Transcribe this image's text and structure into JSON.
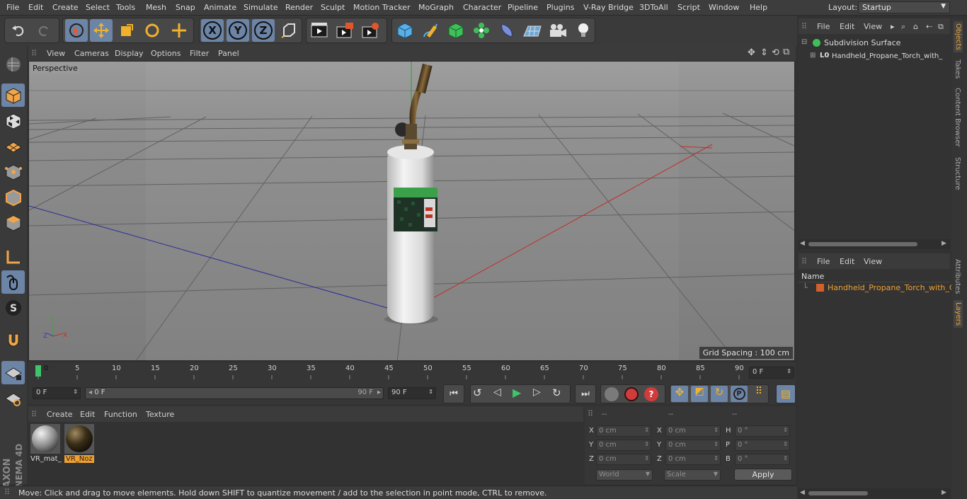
{
  "menu": [
    "File",
    "Edit",
    "Create",
    "Select",
    "Tools",
    "Mesh",
    "Snap",
    "Animate",
    "Simulate",
    "Render",
    "Sculpt",
    "Motion Tracker",
    "MoGraph",
    "Character",
    "Pipeline",
    "Plugins",
    "V-Ray Bridge",
    "3DToAll",
    "Script",
    "Window",
    "Help"
  ],
  "layout": {
    "label": "Layout:",
    "value": "Startup"
  },
  "toolbar": {
    "undo": "undo-icon",
    "redo": "redo-icon",
    "axis_x": "X",
    "axis_y": "Y",
    "axis_z": "Z"
  },
  "viewport": {
    "menu": [
      "View",
      "Cameras",
      "Display",
      "Options",
      "Filter",
      "Panel"
    ],
    "label": "Perspective",
    "grid_spacing": "Grid Spacing : 100 cm",
    "axis_y": "Y",
    "axis_x": "X",
    "axis_z": "Z"
  },
  "timeline": {
    "ticks": [
      "0",
      "5",
      "10",
      "15",
      "20",
      "25",
      "30",
      "35",
      "40",
      "45",
      "50",
      "55",
      "60",
      "65",
      "70",
      "75",
      "80",
      "85",
      "90"
    ],
    "current_frame": "0 F",
    "start": "0 F",
    "range_start": "0 F",
    "range_end": "90 F",
    "end": "90 F"
  },
  "material_manager": {
    "menu": [
      "Create",
      "Edit",
      "Function",
      "Texture"
    ],
    "materials": [
      {
        "name": "VR_mat_",
        "selected": false
      },
      {
        "name": "VR_Noz",
        "selected": true
      }
    ]
  },
  "coordinates": {
    "header": [
      "--",
      "--",
      "--"
    ],
    "pos": [
      {
        "axis": "X",
        "value": "0 cm"
      },
      {
        "axis": "Y",
        "value": "0 cm"
      },
      {
        "axis": "Z",
        "value": "0 cm"
      }
    ],
    "size": [
      {
        "axis": "X",
        "value": "0 cm"
      },
      {
        "axis": "Y",
        "value": "0 cm"
      },
      {
        "axis": "Z",
        "value": "0 cm"
      }
    ],
    "rot": [
      {
        "axis": "H",
        "value": "0 °"
      },
      {
        "axis": "P",
        "value": "0 °"
      },
      {
        "axis": "B",
        "value": "0 °"
      }
    ],
    "mode1": "World",
    "mode2": "Scale",
    "apply": "Apply"
  },
  "objects_panel": {
    "menu": [
      "File",
      "Edit",
      "View"
    ],
    "items": [
      "Subdivision Surface",
      "Handheld_Propane_Torch_with_"
    ]
  },
  "layers_panel": {
    "menu": [
      "File",
      "Edit",
      "View"
    ],
    "column": "Name",
    "items": [
      "Handheld_Propane_Torch_with_C"
    ]
  },
  "side_tabs": [
    "Objects",
    "Takes",
    "Content Browser",
    "Structure",
    "Attributes",
    "Layers"
  ],
  "status": "Move: Click and drag to move elements. Hold down SHIFT to quantize movement / add to the selection in point mode, CTRL to remove.",
  "logo": {
    "brand": "MAXON",
    "product": "CINEMA 4D"
  }
}
